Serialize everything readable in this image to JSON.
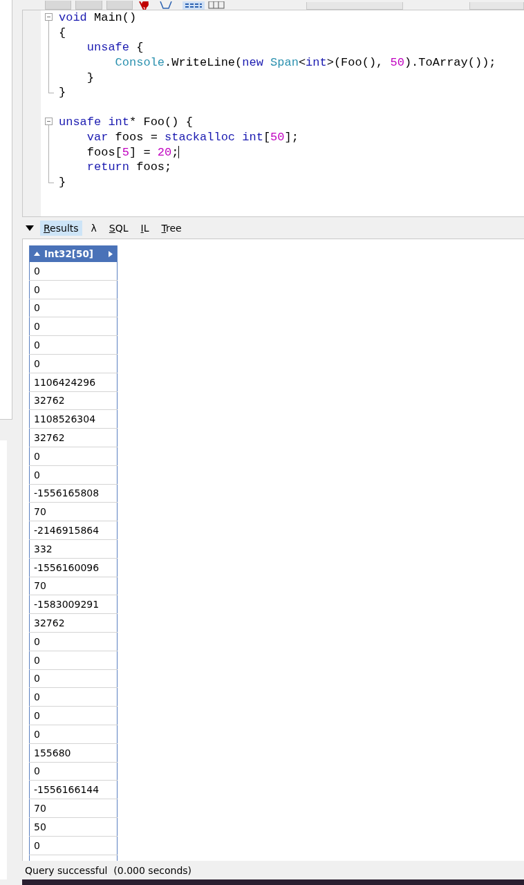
{
  "editor": {
    "lines": [
      {
        "kind": "fold_start",
        "caret": false,
        "tokens": [
          {
            "kind": "keyword",
            "text": "void"
          },
          {
            "kind": "plain",
            "text": " Main()"
          }
        ]
      },
      {
        "kind": "fold_body",
        "caret": false,
        "tokens": [
          {
            "kind": "plain",
            "text": "{"
          }
        ]
      },
      {
        "kind": "fold_body",
        "caret": false,
        "tokens": [
          {
            "kind": "keyword",
            "text": "    unsafe"
          },
          {
            "kind": "plain",
            "text": " {"
          }
        ]
      },
      {
        "kind": "fold_body",
        "caret": false,
        "tokens": [
          {
            "kind": "type",
            "text": "        Console"
          },
          {
            "kind": "plain",
            "text": ".WriteLine("
          },
          {
            "kind": "keyword",
            "text": "new"
          },
          {
            "kind": "type",
            "text": " Span"
          },
          {
            "kind": "plain",
            "text": "<"
          },
          {
            "kind": "keyword",
            "text": "int"
          },
          {
            "kind": "plain",
            "text": ">(Foo(), "
          },
          {
            "kind": "number",
            "text": "50"
          },
          {
            "kind": "plain",
            "text": ").ToArray());"
          }
        ]
      },
      {
        "kind": "fold_body",
        "caret": false,
        "tokens": [
          {
            "kind": "plain",
            "text": "    }"
          }
        ]
      },
      {
        "kind": "fold_end",
        "caret": false,
        "tokens": [
          {
            "kind": "plain",
            "text": "}"
          }
        ]
      },
      {
        "kind": "blank",
        "caret": false
      },
      {
        "kind": "fold_start",
        "caret": false,
        "tokens": [
          {
            "kind": "keyword",
            "text": "unsafe"
          },
          {
            "kind": "keyword",
            "text": " int"
          },
          {
            "kind": "plain",
            "text": "* Foo() {"
          }
        ]
      },
      {
        "kind": "fold_body",
        "caret": false,
        "tokens": [
          {
            "kind": "keyword",
            "text": "    var"
          },
          {
            "kind": "plain",
            "text": " foos = "
          },
          {
            "kind": "keyword",
            "text": "stackalloc"
          },
          {
            "kind": "keyword",
            "text": " int"
          },
          {
            "kind": "plain",
            "text": "["
          },
          {
            "kind": "number",
            "text": "50"
          },
          {
            "kind": "plain",
            "text": "];"
          }
        ]
      },
      {
        "kind": "fold_body",
        "caret": true,
        "tokens": [
          {
            "kind": "plain",
            "text": "    foos["
          },
          {
            "kind": "number",
            "text": "5"
          },
          {
            "kind": "plain",
            "text": "] = "
          },
          {
            "kind": "number",
            "text": "20"
          },
          {
            "kind": "plain",
            "text": ";"
          }
        ]
      },
      {
        "kind": "fold_body",
        "caret": false,
        "tokens": [
          {
            "kind": "keyword",
            "text": "    return"
          },
          {
            "kind": "plain",
            "text": " foos;"
          }
        ]
      },
      {
        "kind": "fold_end",
        "caret": false,
        "tokens": [
          {
            "kind": "plain",
            "text": "}"
          }
        ]
      }
    ]
  },
  "results": {
    "expanded": true,
    "tabs": [
      {
        "label": "Results",
        "selected": true,
        "mnemonic": true
      },
      {
        "label": "λ",
        "selected": false,
        "mnemonic": false
      },
      {
        "label": "SQL",
        "selected": false,
        "mnemonic": true
      },
      {
        "label": "IL",
        "selected": false,
        "mnemonic": true
      },
      {
        "label": "Tree",
        "selected": false,
        "mnemonic": true
      }
    ],
    "table": {
      "header": "Int32[50]",
      "rows": [
        "0",
        "0",
        "0",
        "0",
        "0",
        "0",
        "1106424296",
        "32762",
        "1108526304",
        "32762",
        "0",
        "0",
        "-1556165808",
        "70",
        "-2146915864",
        "332",
        "-1556160096",
        "70",
        "-1583009291",
        "32762",
        "0",
        "0",
        "0",
        "0",
        "0",
        "0",
        "155680",
        "0",
        "-1556166144",
        "70",
        "50",
        "0"
      ]
    }
  },
  "status_bar": {
    "text": "Query successful  (0.000 seconds)"
  }
}
